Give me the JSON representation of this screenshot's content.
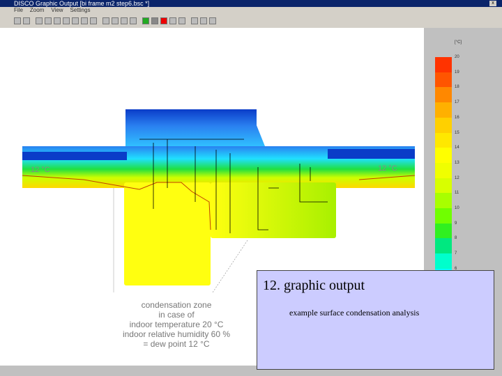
{
  "window": {
    "title": "DISCO   Graphic Output [bi  frame  m2  step6.bsc *]",
    "close": "x"
  },
  "menu": [
    "File",
    "Zoom",
    "View",
    "Settings"
  ],
  "toolbar": [
    "save",
    "print",
    "pan",
    "zoom",
    "back",
    "fwd",
    "fit",
    "prev",
    "copy",
    "measure",
    "select",
    "dots",
    "arrows",
    "M",
    "C",
    "R",
    "frame",
    "page",
    "A",
    "B",
    "lines"
  ],
  "legend": {
    "unit": "[°C]",
    "labels": [
      "20",
      "19",
      "18",
      "17",
      "16",
      "15",
      "14",
      "13",
      "12",
      "11",
      "10",
      "9",
      "8",
      "7",
      "6"
    ],
    "colors": [
      "#ff3300",
      "#ff5500",
      "#ff8800",
      "#ffb000",
      "#ffd000",
      "#ffe800",
      "#ffff00",
      "#f0ff00",
      "#d8ff00",
      "#a8ff00",
      "#70ff00",
      "#30f020",
      "#00e880",
      "#00ffcc",
      "#00ffff"
    ]
  },
  "drawing": {
    "temp_left": "12 °C",
    "temp_right": "12 °C"
  },
  "note": [
    "condensation zone",
    "in case of",
    "indoor temperature 20 °C",
    "indoor relative humidity 60 %",
    "= dew point 12 °C"
  ],
  "overlay": {
    "title": "12. graphic output",
    "subtitle": "example surface condensation analysis"
  }
}
